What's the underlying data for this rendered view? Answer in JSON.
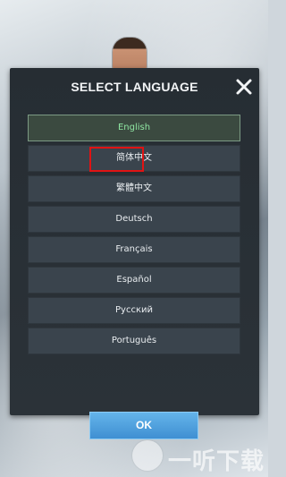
{
  "dialog": {
    "title": "SELECT LANGUAGE",
    "close_icon": "close-icon"
  },
  "languages": [
    {
      "label": "English",
      "selected": true
    },
    {
      "label": "简体中文",
      "selected": false
    },
    {
      "label": "繁體中文",
      "selected": false
    },
    {
      "label": "Deutsch",
      "selected": false
    },
    {
      "label": "Français",
      "selected": false
    },
    {
      "label": "Español",
      "selected": false
    },
    {
      "label": "Русский",
      "selected": false
    },
    {
      "label": "Português",
      "selected": false
    }
  ],
  "ok_label": "OK",
  "highlight": {
    "target": "简体中文",
    "color": "#e01313"
  },
  "watermark": {
    "text": "一听下载"
  },
  "colors": {
    "modal_bg": "#262d33",
    "item_bg": "#3a444d",
    "selected_text": "#8fe6a2",
    "ok_button": "#4f9fe0"
  }
}
